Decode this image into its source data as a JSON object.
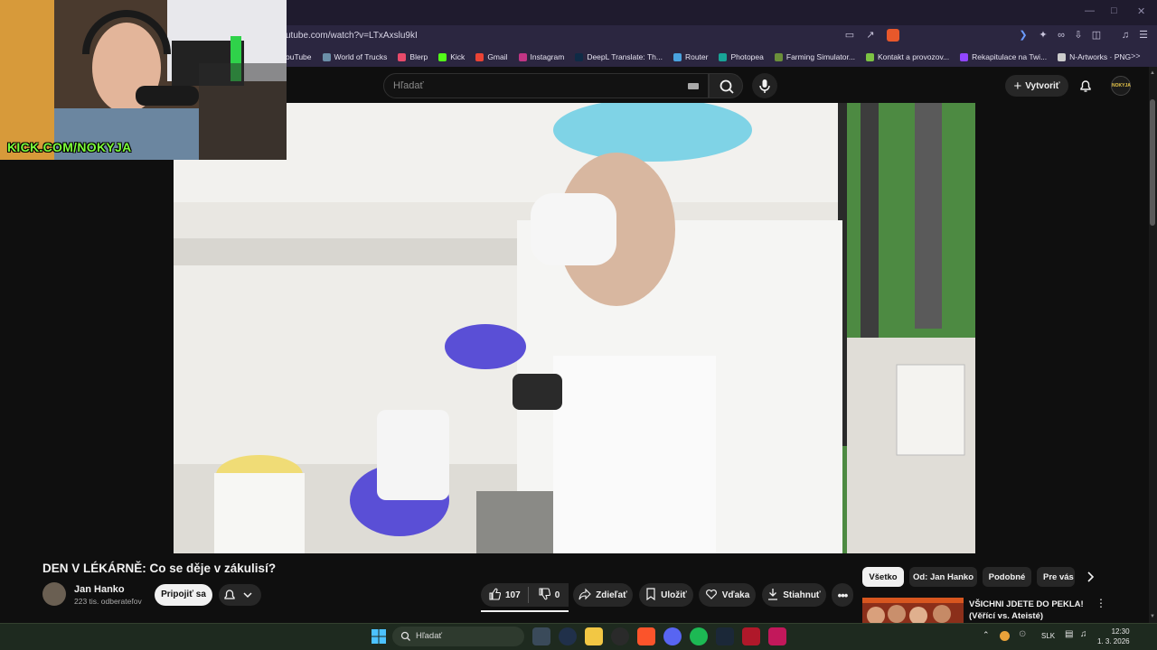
{
  "browser": {
    "url": "utube.com/watch?v=LTxAxslu9kI",
    "bookmarks": [
      {
        "label": "ouTube",
        "color": "#ff0000"
      },
      {
        "label": "World of Trucks",
        "color": "#6b8fa8"
      },
      {
        "label": "Blerp",
        "color": "#e84a6a"
      },
      {
        "label": "Kick",
        "color": "#53fc18"
      },
      {
        "label": "Gmail",
        "color": "#ea4335"
      },
      {
        "label": "Instagram",
        "color": "#c13584"
      },
      {
        "label": "DeepL Translate: Th...",
        "color": "#0f2b46"
      },
      {
        "label": "Router",
        "color": "#4aa3df"
      },
      {
        "label": "Photopea",
        "color": "#18a497"
      },
      {
        "label": "Farming Simulator...",
        "color": "#6b8f3a"
      },
      {
        "label": "Kontakt a provozov...",
        "color": "#7cc243"
      },
      {
        "label": "Rekapitulace na Twi...",
        "color": "#9146ff"
      },
      {
        "label": "N-Artworks · PNG",
        "color": "#cccccc"
      }
    ],
    "overflow_icon": ">>"
  },
  "webcam": {
    "label": "KICK.COM/NOKYJA"
  },
  "youtube": {
    "search_placeholder": "Hľadať",
    "create_label": "Vytvoriť",
    "avatar_label": "NOKYJA"
  },
  "video": {
    "title": "DEN V LÉKÁRNĚ: Co se děje v zákulisí?",
    "channel_name": "Jan Hanko",
    "subscribers": "223 tis. odberateľov",
    "join_label": "Pripojiť sa",
    "like_count": "107",
    "dislike_count": "0",
    "share_label": "Zdieľať",
    "save_label": "Uložiť",
    "thanks_label": "Vďaka",
    "download_label": "Stiahnuť"
  },
  "sidebar": {
    "chips": [
      "Všetko",
      "Od: Jan Hanko",
      "Podobné",
      "Pre vás"
    ],
    "recommendation_title": "VŠICHNI JDETE DO PEKLA! (Věřící vs. Ateisté)"
  },
  "taskbar": {
    "search_placeholder": "Hľadať",
    "language": "SLK",
    "time": "12:30",
    "date": "1. 3. 2026"
  }
}
